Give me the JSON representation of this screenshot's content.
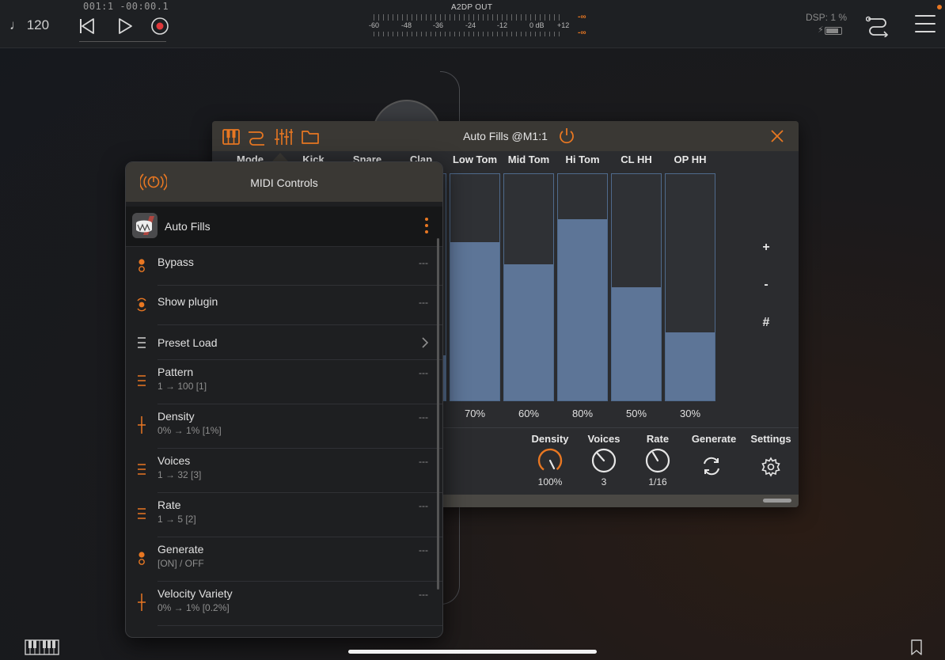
{
  "transport": {
    "tempo": "♩ 120",
    "time": "001:1 -00:00.1"
  },
  "meter": {
    "title": "A2DP OUT",
    "scale": [
      "-60",
      "-48",
      "-36",
      "-24",
      "-12",
      "0 dB",
      "+12"
    ],
    "peak_top": "-∞",
    "peak_bottom": "-∞"
  },
  "status": {
    "dsp": "DSP:  1 %"
  },
  "icons": {
    "rewind": "skip-to-start-icon",
    "play": "play-icon",
    "record": "record-icon",
    "routing": "routing-icon",
    "menu": "hamburger-menu-icon",
    "keyboard": "piano-keyboard-icon",
    "bookmark": "bookmark-icon"
  },
  "colors": {
    "accent": "#e87722",
    "bar_fill": "#5d7597",
    "bar_border": "#4f6a8c"
  },
  "plugin": {
    "title": "Auto Fills @M1:1",
    "columns": [
      {
        "label": "Mode",
        "value": null
      },
      {
        "label": "Kick",
        "value": null
      },
      {
        "label": "Snare",
        "value": null
      },
      {
        "label": "Clap",
        "value": 20,
        "display": ""
      },
      {
        "label": "Low Tom",
        "value": 70,
        "display": "70%"
      },
      {
        "label": "Mid Tom",
        "value": 60,
        "display": "60%"
      },
      {
        "label": "Hi Tom",
        "value": 80,
        "display": "80%"
      },
      {
        "label": "CL HH",
        "value": 50,
        "display": "50%"
      },
      {
        "label": "OP HH",
        "value": 30,
        "display": "30%"
      }
    ],
    "side_buttons": [
      "+",
      "-",
      "#"
    ],
    "controls": [
      {
        "label": "Density",
        "value": "100%"
      },
      {
        "label": "Voices",
        "value": "3"
      },
      {
        "label": "Rate",
        "value": "1/16"
      },
      {
        "label": "Generate",
        "value": ""
      },
      {
        "label": "Settings",
        "value": ""
      }
    ]
  },
  "midi": {
    "title": "MIDI Controls",
    "plugin_name": "Auto Fills",
    "rows": [
      {
        "name": "Bypass",
        "sub": "",
        "value": "---",
        "icon": "toggle"
      },
      {
        "name": "Show plugin",
        "sub": "",
        "value": "---",
        "icon": "momentary"
      },
      {
        "name": "Preset Load",
        "sub": "",
        "value": "",
        "icon": "list",
        "chevron": true
      },
      {
        "name": "Pattern",
        "sub": "1 → 100 [1]",
        "value": "---",
        "icon": "stepped"
      },
      {
        "name": "Density",
        "sub": "0% → 1%  [1%]",
        "value": "---",
        "icon": "slider"
      },
      {
        "name": "Voices",
        "sub": "1 → 32 [3]",
        "value": "---",
        "icon": "stepped"
      },
      {
        "name": "Rate",
        "sub": "1 → 5 [2]",
        "value": "---",
        "icon": "stepped"
      },
      {
        "name": "Generate",
        "sub": "[ON] / OFF",
        "value": "---",
        "icon": "toggle"
      },
      {
        "name": "Velocity Variety",
        "sub": "0% → 1%  [0.2%]",
        "value": "---",
        "icon": "slider"
      }
    ]
  }
}
